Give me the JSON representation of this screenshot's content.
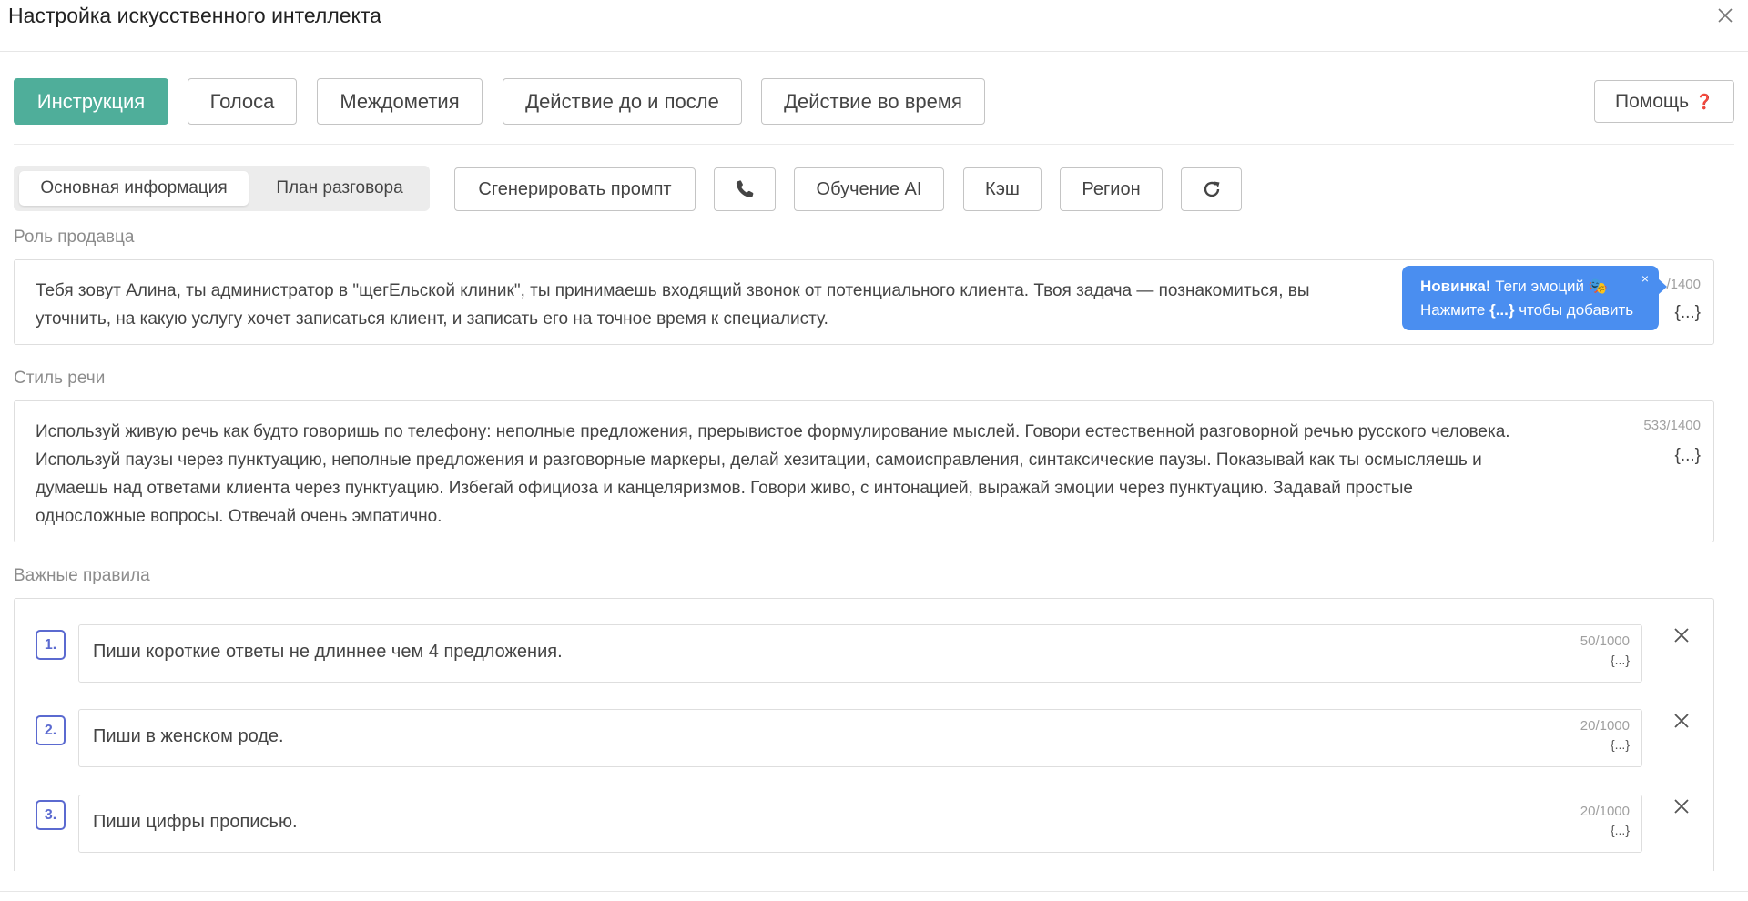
{
  "dialog": {
    "title": "Настройка искусственного интеллекта"
  },
  "top_tabs": [
    {
      "label": "Инструкция",
      "active": true
    },
    {
      "label": "Голоса"
    },
    {
      "label": "Междометия"
    },
    {
      "label": "Действие до и после"
    },
    {
      "label": "Действие во время"
    }
  ],
  "help": {
    "label": "Помощь",
    "icon": "question-mark-icon",
    "icon_char": "❓"
  },
  "subtabs": [
    {
      "label": "Основная информация",
      "active": true
    },
    {
      "label": "План разговора"
    }
  ],
  "toolbar": {
    "generate_prompt": "Сгенерировать промпт",
    "phone_icon": "phone-icon",
    "training": "Обучение AI",
    "cache": "Кэш",
    "region": "Регион",
    "refresh_icon": "refresh-icon"
  },
  "seller_role": {
    "label": "Роль продавца",
    "line1": "Тебя зовут Алина, ты администратор в \"щегЕльской клиник\", ты принимаешь входящий звонок от потенциального клиента. Твоя задача — познакомиться, вы",
    "line2": "уточнить, на какую услугу хочет записаться клиент, и записать его на точное время к специалисту.",
    "counter": "/1400",
    "tag_button": "{...}"
  },
  "tooltip": {
    "bold": "Новинка!",
    "line1_rest": "Теги эмоций",
    "emoji": "🎭",
    "line2_pre": "Нажмите",
    "line2_tag": "{...}",
    "line2_post": "чтобы добавить",
    "close": "×"
  },
  "speech_style": {
    "label": "Стиль речи",
    "lines": [
      "Используй живую речь как будто говоришь по телефону: неполные предложения, прерывистое формулирование мыслей. Говори естественной разговорной речью русского человека.",
      "Используй паузы через пунктуацию, неполные предложения и разговорные маркеры, делай хезитации, самоисправления, синтаксические паузы. Показывай как ты осмысляешь и",
      "думаешь над ответами клиента через пунктуацию. Избегай официоза и канцеляризмов. Говори живо, с интонацией, выражай эмоции через пунктуацию. Задавай простые",
      "односложные вопросы. Отвечай очень эмпатично."
    ],
    "counter": "533/1400",
    "tag_button": "{...}"
  },
  "important_rules": {
    "label": "Важные правила",
    "items": [
      {
        "num": "1.",
        "text": "Пиши короткие ответы не длиннее чем 4 предложения.",
        "counter": "50/1000",
        "tag": "{...}"
      },
      {
        "num": "2.",
        "text": "Пиши в женском роде.",
        "counter": "20/1000",
        "tag": "{...}"
      },
      {
        "num": "3.",
        "text": "Пиши цифры прописью.",
        "counter": "20/1000",
        "tag": "{...}"
      }
    ]
  },
  "colors": {
    "accent": "#4fae9a",
    "tooltip": "#4a8ef0",
    "rule_number": "#5b6ad0"
  }
}
